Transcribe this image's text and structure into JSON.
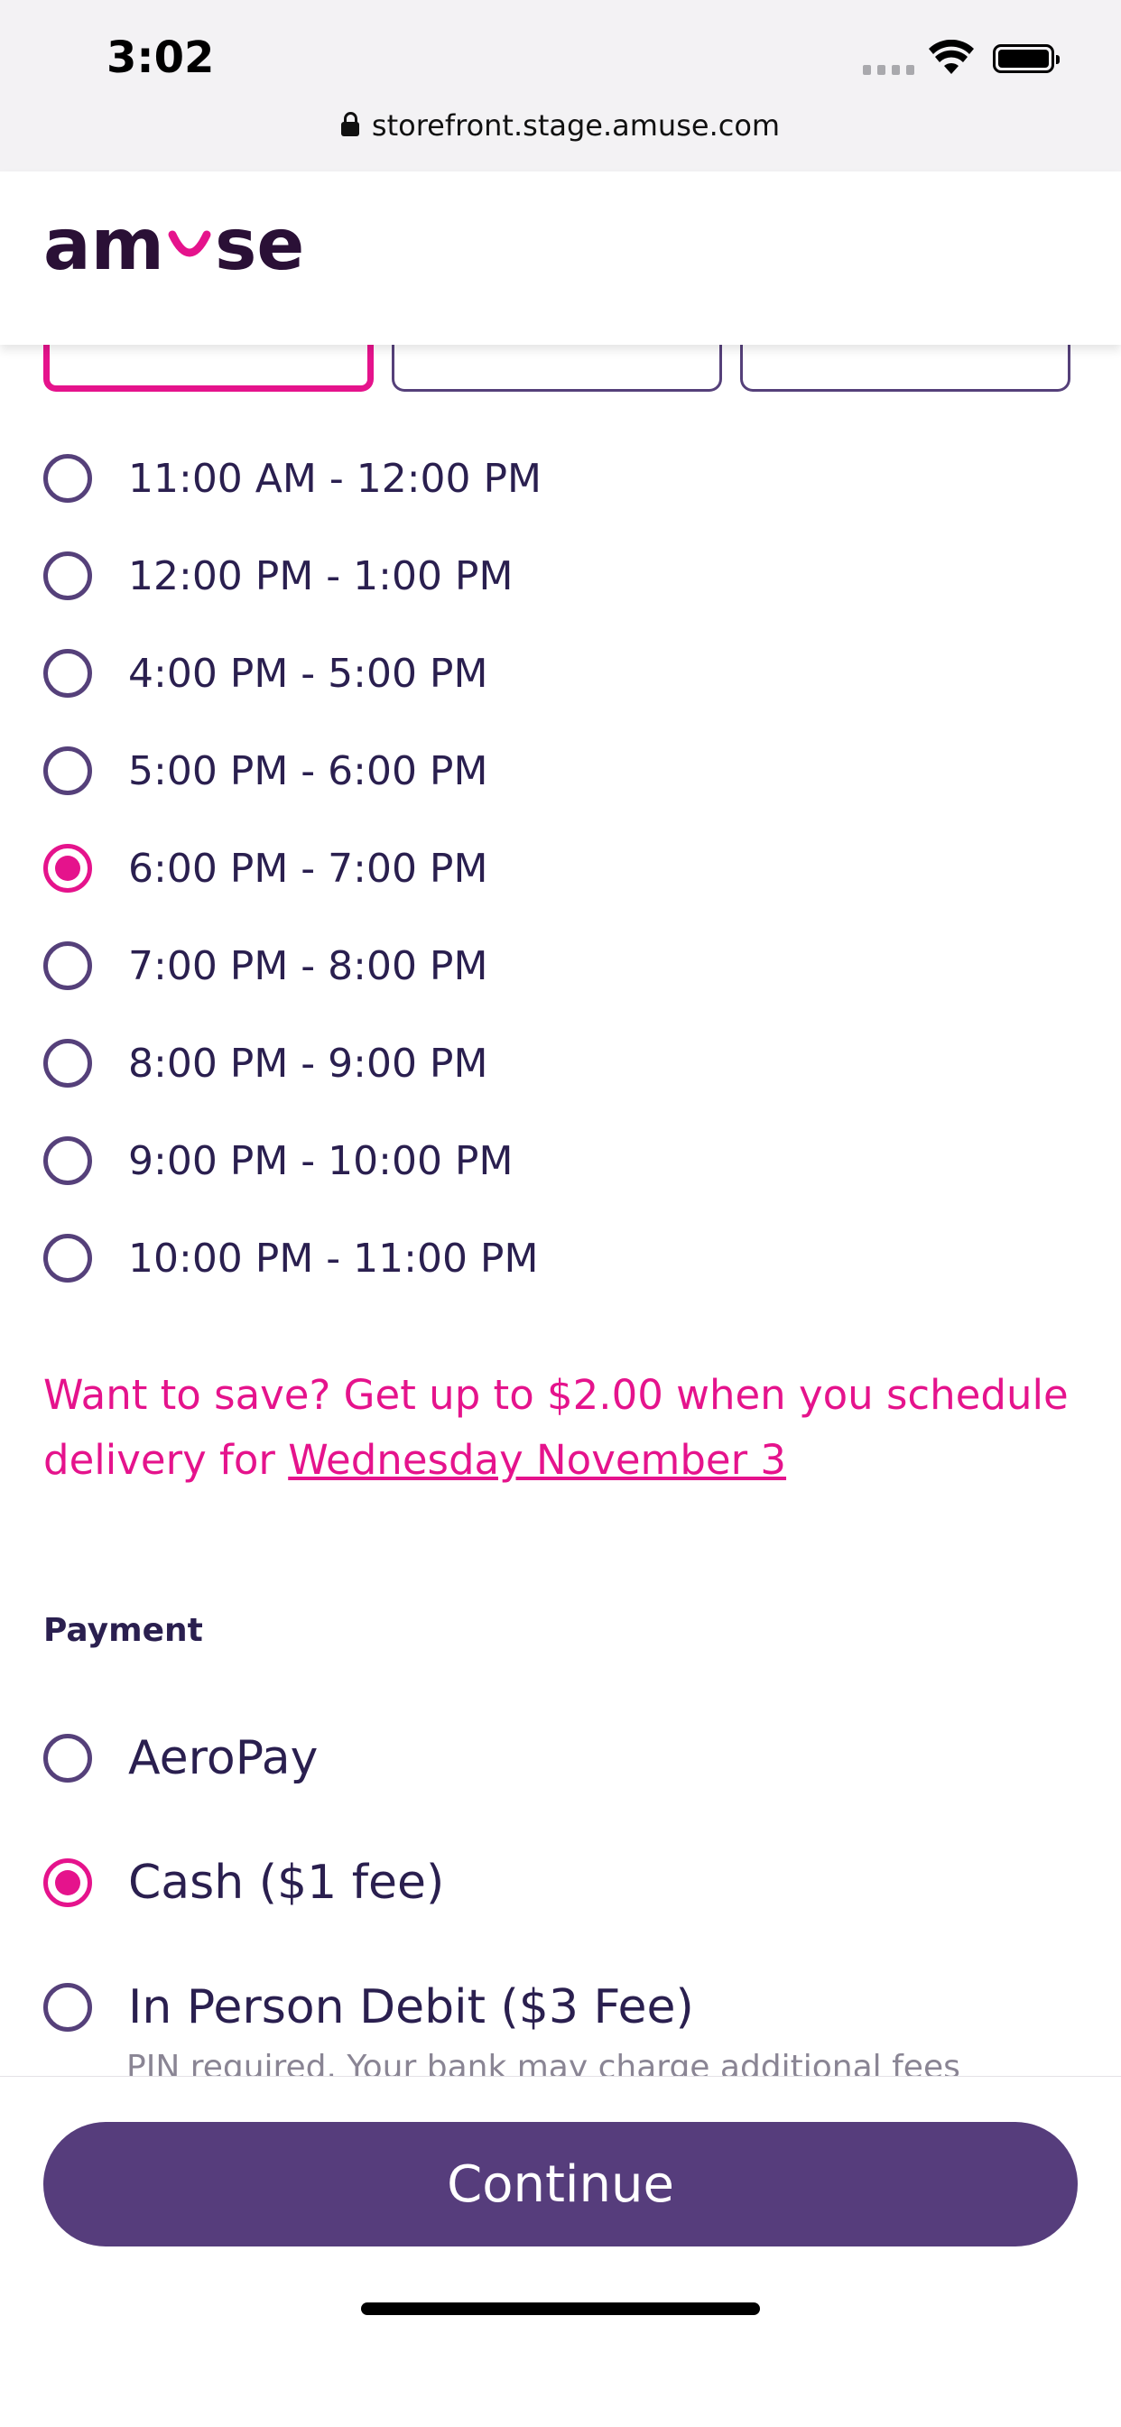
{
  "status_bar": {
    "time": "3:02"
  },
  "browser": {
    "url": "storefront.stage.amuse.com"
  },
  "brand": {
    "name": "amuse",
    "accent": "#e5138c",
    "primary": "#55407a"
  },
  "delivery_slots": [
    {
      "label": "11:00 AM - 12:00 PM",
      "selected": false
    },
    {
      "label": "12:00 PM - 1:00 PM",
      "selected": false
    },
    {
      "label": "4:00 PM - 5:00 PM",
      "selected": false
    },
    {
      "label": "5:00 PM - 6:00 PM",
      "selected": false
    },
    {
      "label": "6:00 PM - 7:00 PM",
      "selected": true
    },
    {
      "label": "7:00 PM - 8:00 PM",
      "selected": false
    },
    {
      "label": "8:00 PM - 9:00 PM",
      "selected": false
    },
    {
      "label": "9:00 PM - 10:00 PM",
      "selected": false
    },
    {
      "label": "10:00 PM - 11:00 PM",
      "selected": false
    }
  ],
  "promo": {
    "text": "Want to save? Get up to $2.00 when you schedule delivery for ",
    "link": "Wednesday November 3"
  },
  "payment": {
    "title": "Payment",
    "options": [
      {
        "label": "AeroPay",
        "selected": false
      },
      {
        "label": "Cash ($1 fee)",
        "selected": true
      },
      {
        "label": "In Person Debit ($3 Fee)",
        "selected": false
      }
    ],
    "debit_note": "PIN required. Your bank may charge additional fees"
  },
  "footer": {
    "continue_label": "Continue"
  }
}
